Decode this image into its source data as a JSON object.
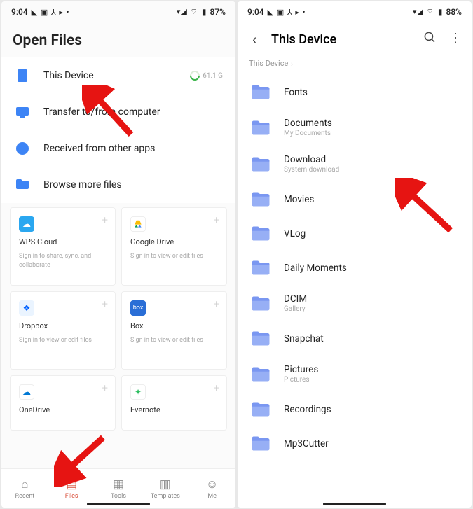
{
  "left": {
    "status": {
      "time": "9:04",
      "battery": "87%"
    },
    "title": "Open Files",
    "items": [
      {
        "label": "This Device",
        "storage": "61.1 G"
      },
      {
        "label": "Transfer to/from computer"
      },
      {
        "label": "Received from other apps"
      },
      {
        "label": "Browse more files"
      }
    ],
    "clouds": [
      {
        "name": "WPS Cloud",
        "sub": "Sign in to share, sync, and collaborate",
        "bg": "#2aa7f0"
      },
      {
        "name": "Google Drive",
        "sub": "Sign in to view or edit files",
        "bg": "#ffffff"
      },
      {
        "name": "Dropbox",
        "sub": "Sign in to view or edit files",
        "bg": "#eaf4ff"
      },
      {
        "name": "Box",
        "sub": "Sign in to view or edit files",
        "bg": "#2a6ed6"
      },
      {
        "name": "OneDrive",
        "sub": "",
        "bg": "#ffffff"
      },
      {
        "name": "Evernote",
        "sub": "",
        "bg": "#ffffff"
      }
    ],
    "nav": [
      {
        "label": "Recent"
      },
      {
        "label": "Files"
      },
      {
        "label": "Tools"
      },
      {
        "label": "Templates"
      },
      {
        "label": "Me"
      }
    ]
  },
  "right": {
    "status": {
      "time": "9:04",
      "battery": "88%"
    },
    "title": "This Device",
    "breadcrumb": "This Device",
    "folders": [
      {
        "name": "Fonts"
      },
      {
        "name": "Documents",
        "sub": "My Documents"
      },
      {
        "name": "Download",
        "sub": "System download"
      },
      {
        "name": "Movies"
      },
      {
        "name": "VLog"
      },
      {
        "name": "Daily Moments"
      },
      {
        "name": "DCIM",
        "sub": "Gallery"
      },
      {
        "name": "Snapchat"
      },
      {
        "name": "Pictures",
        "sub": "Pictures"
      },
      {
        "name": "Recordings"
      },
      {
        "name": "Mp3Cutter"
      }
    ]
  }
}
